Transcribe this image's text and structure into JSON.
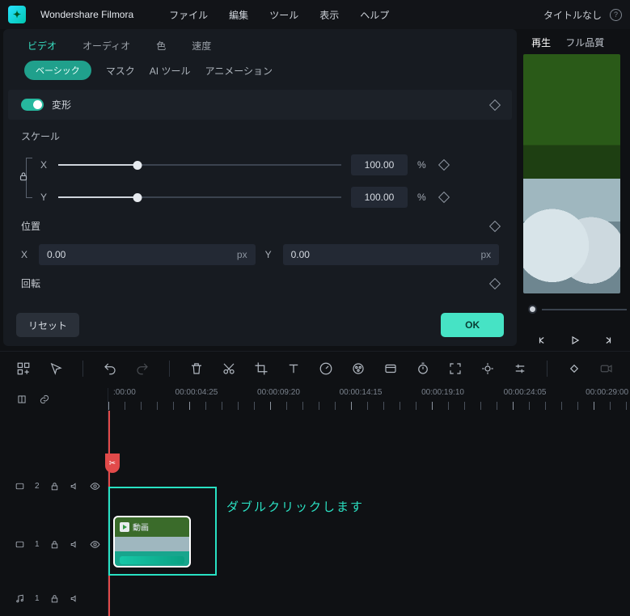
{
  "app": {
    "name": "Wondershare Filmora",
    "project": "タイトルなし"
  },
  "menu": [
    "ファイル",
    "編集",
    "ツール",
    "表示",
    "ヘルプ"
  ],
  "preview_tabs": {
    "play": "再生",
    "quality": "フル品質"
  },
  "tabs1": {
    "video": "ビデオ",
    "audio": "オーディオ",
    "color": "色",
    "speed": "速度"
  },
  "tabs2": {
    "basic": "ベーシック",
    "mask": "マスク",
    "ai": "AI ツール",
    "anim": "アニメーション"
  },
  "section": {
    "transform": "変形"
  },
  "scale": {
    "label": "スケール",
    "x_label": "X",
    "y_label": "Y",
    "x_value": "100.00",
    "y_value": "100.00",
    "unit": "%"
  },
  "position": {
    "label": "位置",
    "x_label": "X",
    "x_value": "0.00",
    "y_label": "Y",
    "y_value": "0.00",
    "unit": "px"
  },
  "rotation": {
    "label": "回転"
  },
  "buttons": {
    "reset": "リセット",
    "ok": "OK"
  },
  "ruler": {
    "t0": ":00:00",
    "t1": "00:00:04:25",
    "t2": "00:00:09:20",
    "t3": "00:00:14:15",
    "t4": "00:00:19:10",
    "t5": "00:00:24:05",
    "t6": "00:00:29:00"
  },
  "tracks": {
    "v2": "2",
    "v1": "1",
    "a1": "1"
  },
  "clip": {
    "label": "動画"
  },
  "hint": "ダブルクリックします"
}
